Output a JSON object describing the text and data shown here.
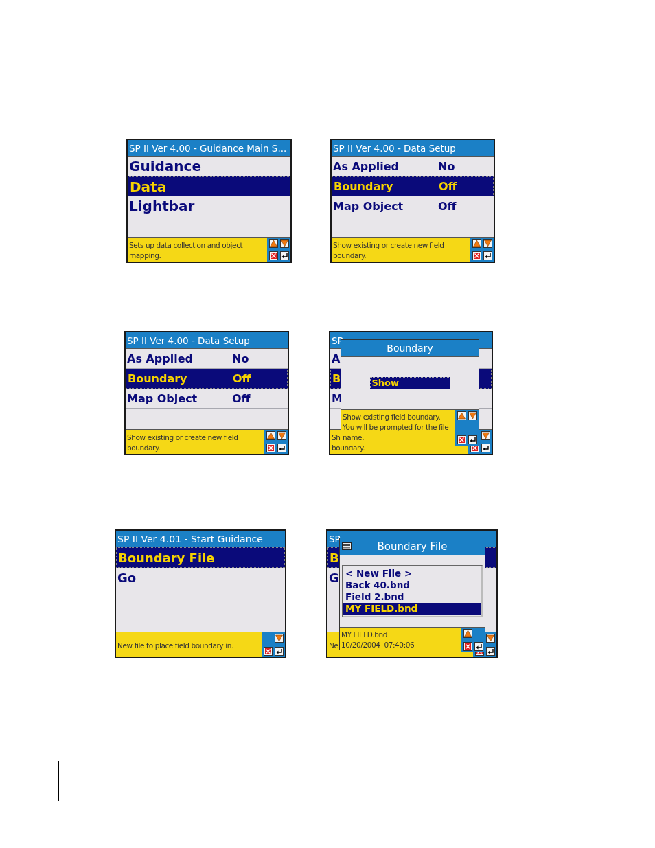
{
  "screens": [
    {
      "title": "SP II Ver 4.00 - Guidance Main S...",
      "rows": [
        {
          "label": "Guidance",
          "selected": false
        },
        {
          "label": "Data",
          "selected": true
        },
        {
          "label": "Lightbar",
          "selected": false
        }
      ],
      "hint": [
        "Sets up data collection and object",
        "mapping."
      ],
      "keys": [
        {
          "kind": "up"
        },
        {
          "kind": "down"
        },
        {
          "kind": "cancel"
        },
        {
          "kind": "enter"
        }
      ]
    },
    {
      "title": "SP II Ver 4.00 - Data Setup",
      "rows": [
        {
          "label": "As Applied",
          "value": "No",
          "selected": false
        },
        {
          "label": "Boundary",
          "value": "Off",
          "selected": true
        },
        {
          "label": "Map Object",
          "value": "Off",
          "selected": false
        }
      ],
      "hint": [
        "Show existing or create new field",
        "boundary."
      ],
      "keys": [
        {
          "kind": "up"
        },
        {
          "kind": "down"
        },
        {
          "kind": "cancel"
        },
        {
          "kind": "enter"
        }
      ]
    },
    {
      "title": "SP II Ver 4.00 - Data Setup",
      "rows": [
        {
          "label": "As Applied",
          "value": "No",
          "selected": false
        },
        {
          "label": "Boundary",
          "value": "Off",
          "selected": true
        },
        {
          "label": "Map Object",
          "value": "Off",
          "selected": false
        }
      ],
      "hint": [
        "Show existing or create new field",
        "boundary."
      ],
      "keys": [
        {
          "kind": "up"
        },
        {
          "kind": "down"
        },
        {
          "kind": "cancel"
        },
        {
          "kind": "enter"
        }
      ]
    },
    {
      "title": "SP",
      "rows": [
        {
          "label": "A",
          "selected": false
        },
        {
          "label": "B",
          "selected": true
        },
        {
          "label": "M",
          "selected": false
        }
      ],
      "hint": [
        "Sh",
        "boundary."
      ],
      "keys": [
        {
          "kind": "down"
        },
        {
          "kind": "cancel"
        },
        {
          "kind": "enter"
        }
      ],
      "dialog": {
        "title": "Boundary",
        "has_icon": false,
        "kind": "choice",
        "options": [
          {
            "label": "Show",
            "selected": true
          }
        ],
        "hint": [
          "Show existing field boundary.",
          "You will be prompted for the file",
          "name."
        ],
        "keys": [
          {
            "kind": "up"
          },
          {
            "kind": "down"
          },
          {
            "kind": "cancel"
          },
          {
            "kind": "enter"
          }
        ]
      }
    },
    {
      "title": "SP II Ver 4.01 - Start Guidance",
      "rows": [
        {
          "label": "Boundary File",
          "selected": true
        },
        {
          "label": "Go",
          "selected": false
        }
      ],
      "hint": [
        "New file to place field boundary in."
      ],
      "keys": [
        {
          "kind": "down"
        },
        {
          "kind": "cancel"
        },
        {
          "kind": "enter"
        }
      ]
    },
    {
      "title": "SP",
      "rows": [
        {
          "label": "B",
          "selected": true
        },
        {
          "label": "G",
          "selected": false
        }
      ],
      "hint": [
        "Ne"
      ],
      "keys": [
        {
          "kind": "down"
        },
        {
          "kind": "cancel"
        },
        {
          "kind": "enter"
        }
      ],
      "dialog": {
        "title": "Boundary File",
        "has_icon": true,
        "kind": "list",
        "options": [
          {
            "label": "< New File >",
            "selected": false
          },
          {
            "label": "Back 40.bnd",
            "selected": false
          },
          {
            "label": "Field 2.bnd",
            "selected": false
          },
          {
            "label": "MY FIELD.bnd",
            "selected": true
          }
        ],
        "hint": [
          "MY FIELD.bnd",
          "10/20/2004  07:40:06"
        ],
        "keys": [
          {
            "kind": "up"
          },
          {
            "kind": "cancel"
          },
          {
            "kind": "enter"
          }
        ]
      }
    }
  ]
}
